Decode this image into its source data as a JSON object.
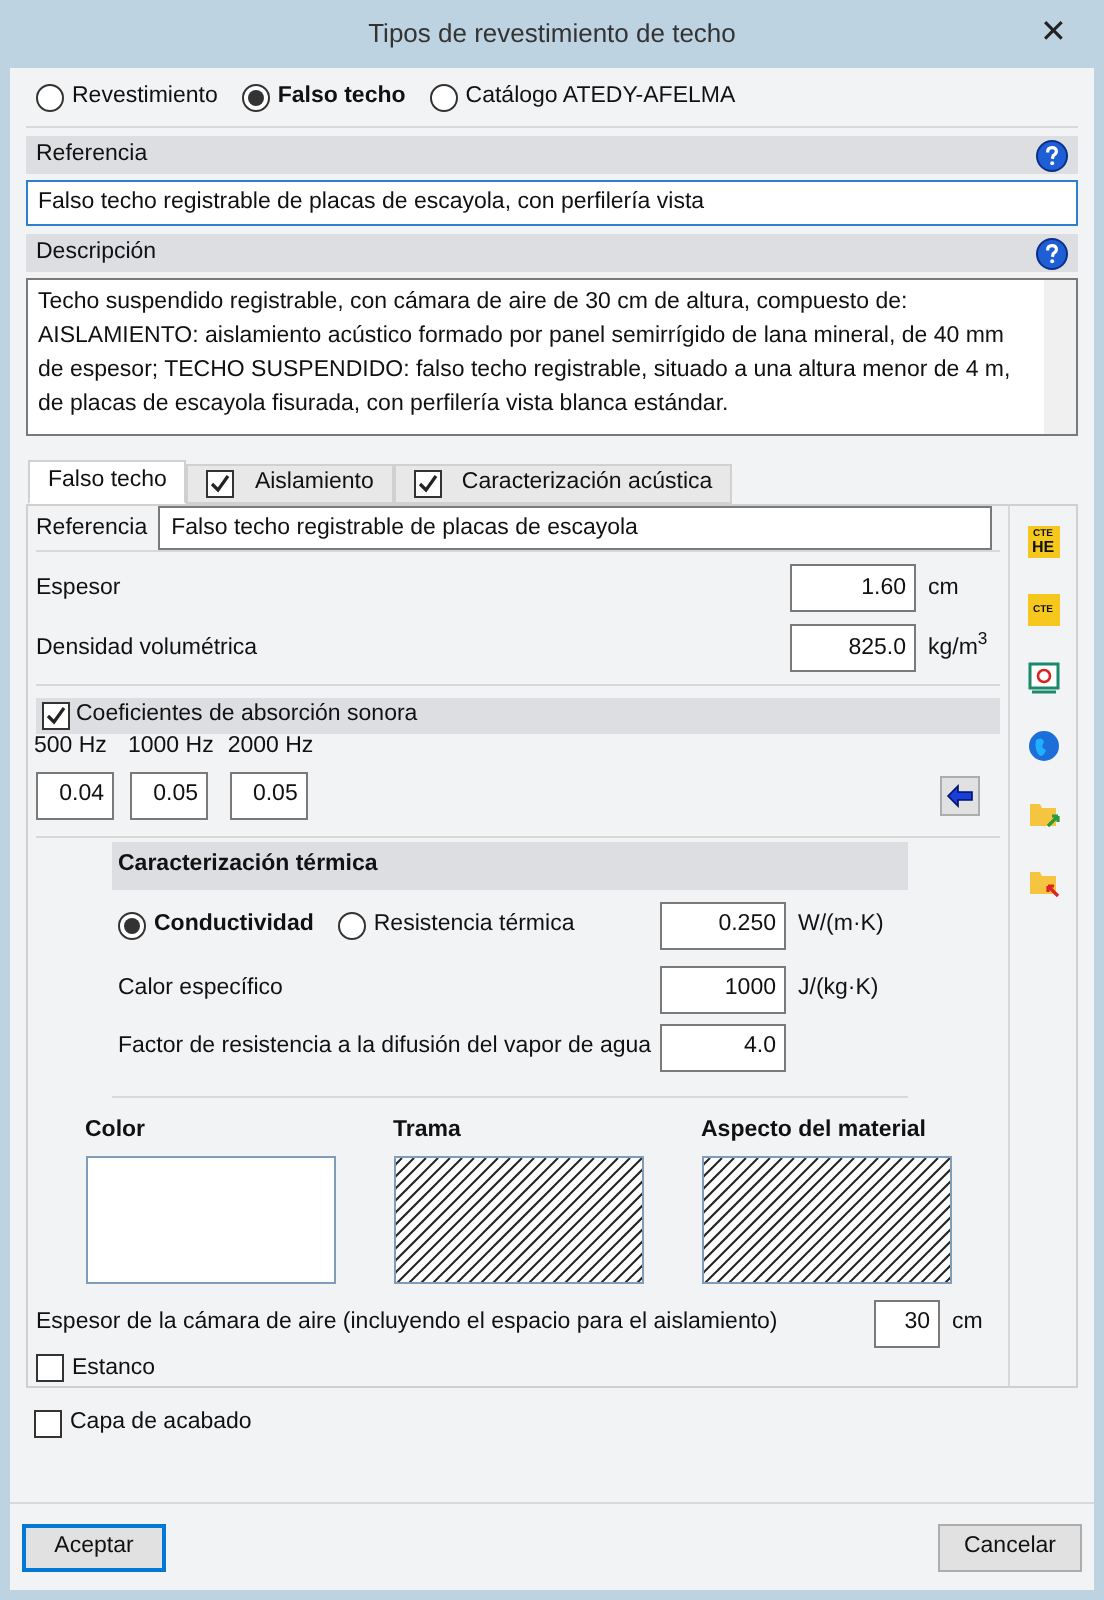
{
  "window": {
    "title": "Tipos de revestimiento de techo",
    "close": "✕"
  },
  "type_options": [
    {
      "label": "Revestimiento",
      "selected": false
    },
    {
      "label": "Falso techo",
      "selected": true
    },
    {
      "label": "Catálogo ATEDY-AFELMA",
      "selected": false
    }
  ],
  "reference": {
    "header": "Referencia",
    "value": "Falso techo registrable de placas de escayola, con perfilería vista"
  },
  "description": {
    "header": "Descripción",
    "value": "Techo suspendido registrable, con cámara de aire de 30 cm de altura, compuesto de: AISLAMIENTO: aislamiento acústico formado por panel semirrígido de lana mineral, de 40 mm de espesor; TECHO SUSPENDIDO: falso techo registrable, situado a una altura menor de 4 m, de placas de escayola fisurada, con perfilería vista blanca estándar."
  },
  "tabs": [
    {
      "label": "Falso techo",
      "selected": true
    },
    {
      "label": "Aislamiento",
      "selected": false,
      "checked": true
    },
    {
      "label": "Caracterización acústica",
      "selected": false,
      "checked": true
    }
  ],
  "panel": {
    "reference": {
      "label": "Referencia",
      "value": "Falso techo registrable de placas de escayola"
    },
    "properties": [
      {
        "label": "Espesor",
        "value": "1.60",
        "unit": "cm"
      },
      {
        "label": "Densidad volumétrica",
        "value": "825.0",
        "unit": "kg/m$^{3}$"
      }
    ],
    "absorption": {
      "label": "Coeficientes de absorción sonora",
      "checked": true,
      "bands": [
        {
          "label": "500 Hz",
          "value": "0.04"
        },
        {
          "label": "1000 Hz",
          "value": "0.05"
        },
        {
          "label": "2000 Hz",
          "value": "0.05"
        }
      ]
    },
    "thermal": {
      "header": "Caracterización térmica",
      "modes": [
        {
          "label": "Conductividad",
          "selected": true
        },
        {
          "label": "Resistencia térmica",
          "selected": false
        }
      ],
      "mode_value": "0.250",
      "mode_unit": "W/(m·K)",
      "rows": [
        {
          "label": "Calor específico",
          "value": "1000",
          "unit": "J/(kg·K)"
        },
        {
          "label": "Factor de resistencia a la difusión del vapor de agua",
          "value": "4.0"
        }
      ]
    },
    "swatches": [
      {
        "label": "Color",
        "kind": "color",
        "color": "#ffffff"
      },
      {
        "label": "Trama",
        "kind": "hatch"
      },
      {
        "label": "Aspecto del material",
        "kind": "hatch"
      }
    ],
    "air_gap": {
      "label": "Espesor de la cámara de aire (incluyendo el espacio para el aislamiento)",
      "value": "30",
      "unit": "cm"
    },
    "sealed": {
      "label": "Estanco",
      "checked": false
    }
  },
  "side_tools": [
    {
      "kind": "badge",
      "top": "CTE",
      "bottom": "HE"
    },
    {
      "kind": "badge",
      "top": "CTE"
    },
    {
      "kind": "certificate"
    },
    {
      "kind": "globe"
    },
    {
      "kind": "folder-import"
    },
    {
      "kind": "folder-export"
    }
  ],
  "finish_layer": {
    "label": "Capa de acabado",
    "checked": false
  },
  "buttons": [
    {
      "label": "Aceptar",
      "default": true
    },
    {
      "label": "Cancelar",
      "default": false
    }
  ]
}
